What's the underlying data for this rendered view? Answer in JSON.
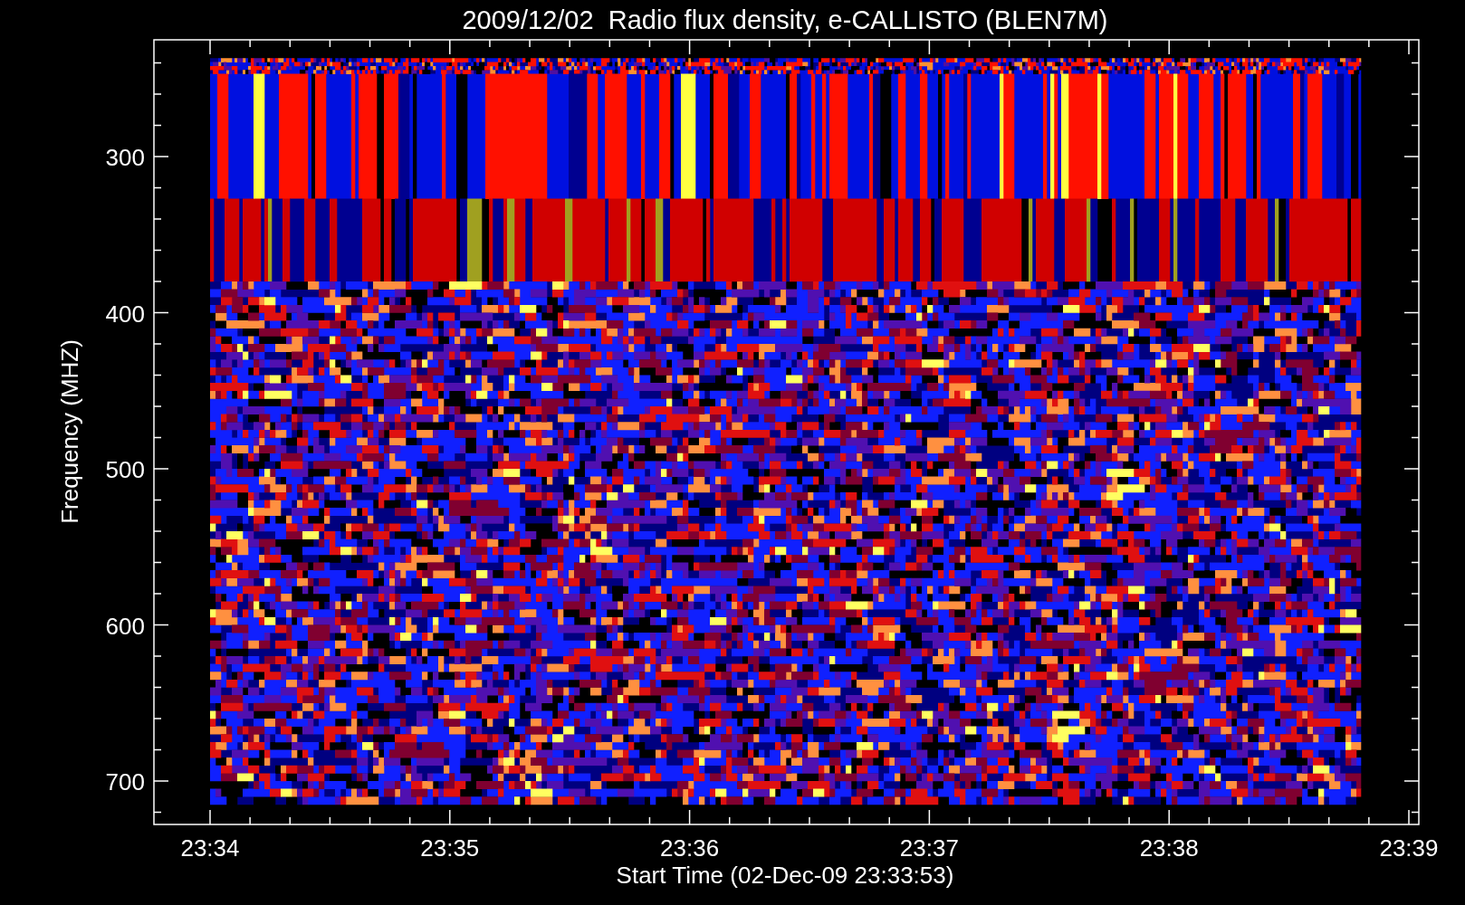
{
  "title": "2009/12/02  Radio flux density, e-CALLISTO (BLEN7M)",
  "plot": {
    "ylabel": "Frequency (MHZ)",
    "xlabel": "Start Time (02-Dec-09 23:33:53)",
    "yticks": [
      "300",
      "400",
      "500",
      "600",
      "700"
    ],
    "xticks": [
      "23:34",
      "23:35",
      "23:36",
      "23:37",
      "23:38",
      "23:39"
    ]
  }
}
